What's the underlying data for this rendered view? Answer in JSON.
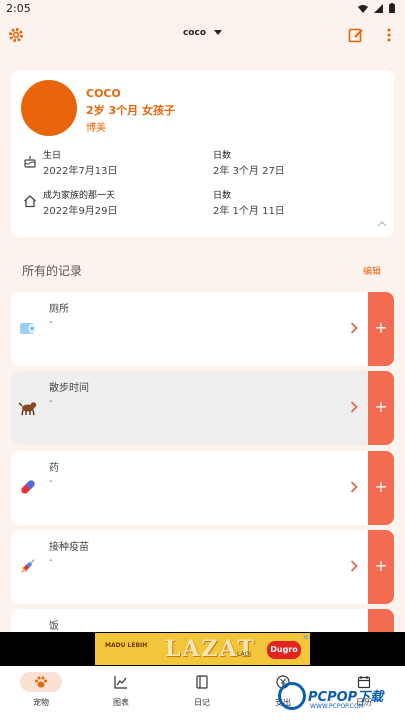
{
  "status_bar": {
    "time": "2:05"
  },
  "header": {
    "pet_selector": "coco"
  },
  "profile": {
    "name": "COCO",
    "age_gender": "2岁 3个月 女孩子",
    "breed": "博美",
    "birthday": {
      "label": "生日",
      "value": "2022年7月13日"
    },
    "birthday_days": {
      "label": "日数",
      "value": "2年 3个月 27日"
    },
    "joined": {
      "label": "成为家族的那一天",
      "value": "2022年9月29日"
    },
    "joined_days": {
      "label": "日数",
      "value": "2年 1个月 11日"
    }
  },
  "records_section": {
    "title": "所有的记录",
    "edit_label": "编辑",
    "items": [
      {
        "name": "厕所",
        "value": "-",
        "icon": "toilet-paper-icon"
      },
      {
        "name": "散步时间",
        "value": "-",
        "icon": "dog-walk-icon"
      },
      {
        "name": "药",
        "value": "-",
        "icon": "pill-icon"
      },
      {
        "name": "接种疫苗",
        "value": "-",
        "icon": "syringe-icon"
      },
      {
        "name": "饭",
        "value": "",
        "icon": "food-icon"
      }
    ],
    "add_label": "+"
  },
  "ad": {
    "headline": "LAZAT",
    "tag1": "MADU LEBIH",
    "tag2": "LAGI",
    "brand": "Dugro"
  },
  "bottom_nav": {
    "items": [
      {
        "label": "宠物",
        "active": true
      },
      {
        "label": "图表",
        "active": false
      },
      {
        "label": "日记",
        "active": false
      },
      {
        "label": "支出",
        "active": false
      },
      {
        "label": "日历",
        "active": false
      }
    ]
  },
  "watermark": {
    "text": "PCPOP下载",
    "url": "WWW.PCPOP.COM"
  },
  "colors": {
    "accent": "#e8650a",
    "plus_button": "#f36b50",
    "background": "#fdf3ee"
  }
}
